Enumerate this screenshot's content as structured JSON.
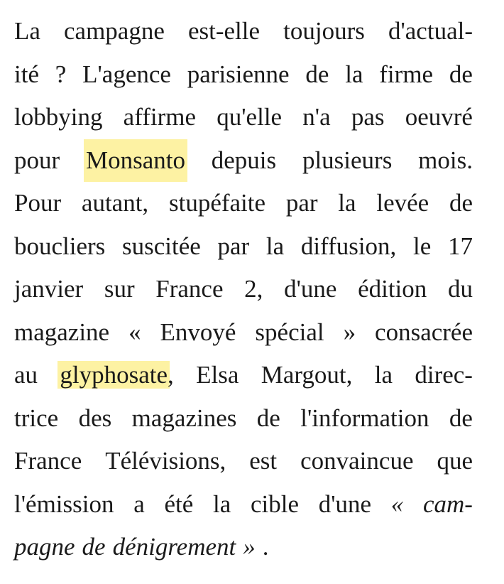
{
  "article": {
    "lines": [
      [
        "La",
        "campagne",
        "est-elle",
        "toujours",
        "d'actual-"
      ],
      [
        "ité",
        "?",
        "L'agence",
        "parisienne",
        "de",
        "la",
        "firme",
        "de"
      ],
      [
        "lobbying",
        "affirme",
        "qu'elle",
        "n'a",
        "pas",
        "oeuvré"
      ],
      [
        "pour",
        "Monsanto",
        "depuis",
        "plusieurs",
        "mois."
      ],
      [
        "Pour",
        "autant,",
        "stupéfaite",
        "par",
        "la",
        "levée",
        "de"
      ],
      [
        "boucliers",
        "suscitée",
        "par",
        "la",
        "diffusion,",
        "le",
        "17"
      ],
      [
        "janvier",
        "sur",
        "France",
        "2,",
        "d'une",
        "édition",
        "du"
      ],
      [
        "magazine",
        "«",
        "Envoyé",
        "spécial",
        "»",
        "consacrée"
      ],
      [
        "au",
        "glyphosate,",
        "Elsa",
        "Margout,",
        "la",
        "direc-"
      ],
      [
        "trice",
        "des",
        "magazines",
        "de",
        "l'information",
        "de"
      ],
      [
        "France",
        "Télévisions,",
        "est",
        "convaincue",
        "que"
      ],
      [
        "l'émission",
        "a",
        "été",
        "la",
        "cible",
        "d'une",
        "«",
        "cam-"
      ],
      [
        "pagne",
        "de",
        "dénigrement",
        "»",
        "."
      ]
    ],
    "highlights": [
      "Monsanto",
      "glyphosate"
    ],
    "highlight_color": "#fdf2a3"
  }
}
